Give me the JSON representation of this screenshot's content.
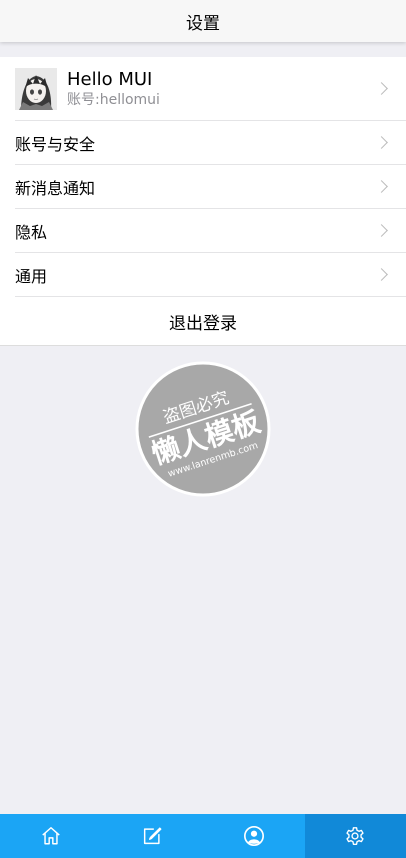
{
  "header": {
    "title": "设置"
  },
  "profile": {
    "name": "Hello MUI",
    "account": "账号:hellomui"
  },
  "menu": [
    {
      "label": "账号与安全"
    },
    {
      "label": "新消息通知"
    },
    {
      "label": "隐私"
    },
    {
      "label": "通用"
    }
  ],
  "logout": {
    "label": "退出登录"
  },
  "watermark": {
    "line1": "盗图必究",
    "line2": "懒人模板",
    "line3": "www.lanrenmb.com"
  },
  "tabbar": {
    "items": [
      {
        "icon": "home-icon"
      },
      {
        "icon": "edit-icon"
      },
      {
        "icon": "contact-icon"
      },
      {
        "icon": "gear-icon",
        "active": true
      }
    ],
    "color": "#1ba5f5",
    "active_color": "#1189d8"
  }
}
